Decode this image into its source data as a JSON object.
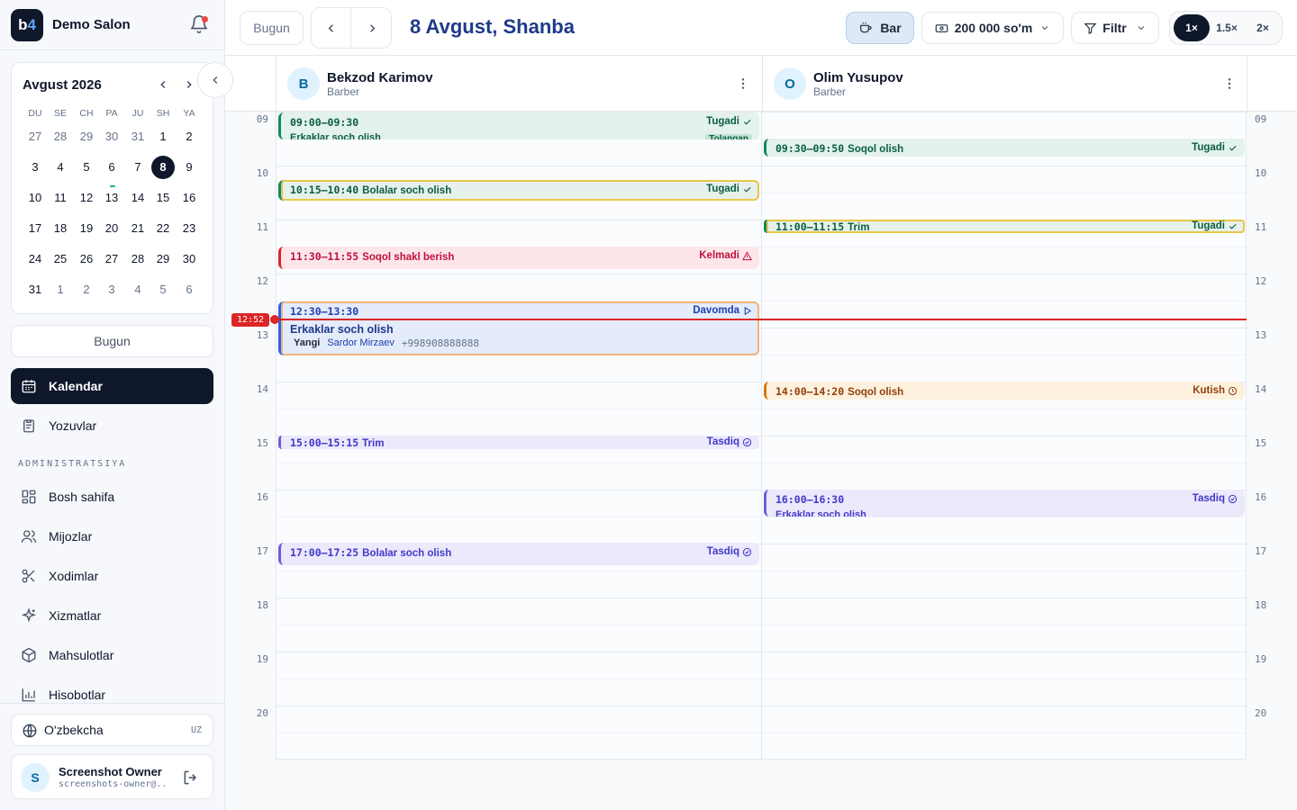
{
  "sidebar": {
    "logo": {
      "b": "b",
      "n": "4"
    },
    "salon_name": "Demo Salon",
    "calendar": {
      "month_title": "Avgust 2026",
      "weekdays": [
        "DU",
        "SE",
        "CH",
        "PA",
        "JU",
        "SH",
        "YA"
      ],
      "weeks": [
        [
          "27",
          "28",
          "29",
          "30",
          "31",
          "1",
          "2"
        ],
        [
          "3",
          "4",
          "5",
          "6",
          "7",
          "8",
          "9"
        ],
        [
          "10",
          "11",
          "12",
          "13",
          "14",
          "15",
          "16"
        ],
        [
          "17",
          "18",
          "19",
          "20",
          "21",
          "22",
          "23"
        ],
        [
          "24",
          "25",
          "26",
          "27",
          "28",
          "29",
          "30"
        ],
        [
          "31",
          "1",
          "2",
          "3",
          "4",
          "5",
          "6"
        ]
      ],
      "selected_day": "8"
    },
    "today_label": "Bugun",
    "nav": [
      {
        "label": "Kalendar"
      },
      {
        "label": "Yozuvlar"
      }
    ],
    "admin_label": "ADMINISTRATSIYA",
    "admin_nav": [
      {
        "label": "Bosh sahifa"
      },
      {
        "label": "Mijozlar"
      },
      {
        "label": "Xodimlar"
      },
      {
        "label": "Xizmatlar"
      },
      {
        "label": "Mahsulotlar"
      },
      {
        "label": "Hisobotlar"
      }
    ],
    "language": {
      "label": "O'zbekcha",
      "code": "UZ"
    },
    "user": {
      "initial": "S",
      "name": "Screenshot Owner",
      "email": "screenshots-owner@..."
    }
  },
  "topbar": {
    "today_label": "Bugun",
    "date_title": "8 Avgust, Shanba",
    "bar_label": "Bar",
    "amount_label": "200 000 so'm",
    "filter_label": "Filtr",
    "zoom": [
      "1×",
      "1.5×",
      "2×"
    ],
    "zoom_selected": "1×"
  },
  "calendar": {
    "hours": [
      "09",
      "10",
      "11",
      "12",
      "13",
      "14",
      "15",
      "16",
      "17",
      "18",
      "19",
      "20"
    ],
    "now": "12:52",
    "staff": [
      {
        "initial": "B",
        "name": "Bekzod Karimov",
        "role": "Barber"
      },
      {
        "initial": "O",
        "name": "Olim Yusupov",
        "role": "Barber"
      }
    ],
    "events": [
      {
        "time": "09:00–09:30",
        "title": "",
        "status": "Tugadi",
        "line2": "Erkaklar soch olish",
        "tag": "Tolangan"
      },
      {
        "time": "10:15–10:40",
        "title": "Bolalar soch olish",
        "status": "Tugadi"
      },
      {
        "time": "11:30–11:55",
        "title": "Soqol shakl berish",
        "status": "Kelmadi"
      },
      {
        "time": "12:30–13:30",
        "title": "",
        "status": "Davomda",
        "service": "Erkaklar soch olish",
        "client_tag": "Yangi",
        "client": "Sardor Mirzaev",
        "phone": "+998908888888"
      },
      {
        "time": "15:00–15:15",
        "title": "Trim",
        "status": "Tasdiq"
      },
      {
        "time": "17:00–17:25",
        "title": "Bolalar soch olish",
        "status": "Tasdiq"
      },
      {
        "time": "09:30–09:50",
        "title": "Soqol olish",
        "status": "Tugadi"
      },
      {
        "time": "11:00–11:15",
        "title": "Trim",
        "status": "Tugadi"
      },
      {
        "time": "14:00–14:20",
        "title": "Soqol olish",
        "status": "Kutish"
      },
      {
        "time": "16:00–16:30",
        "title": "",
        "status": "Tasdiq",
        "line2": "Erkaklar soch olish"
      }
    ]
  }
}
